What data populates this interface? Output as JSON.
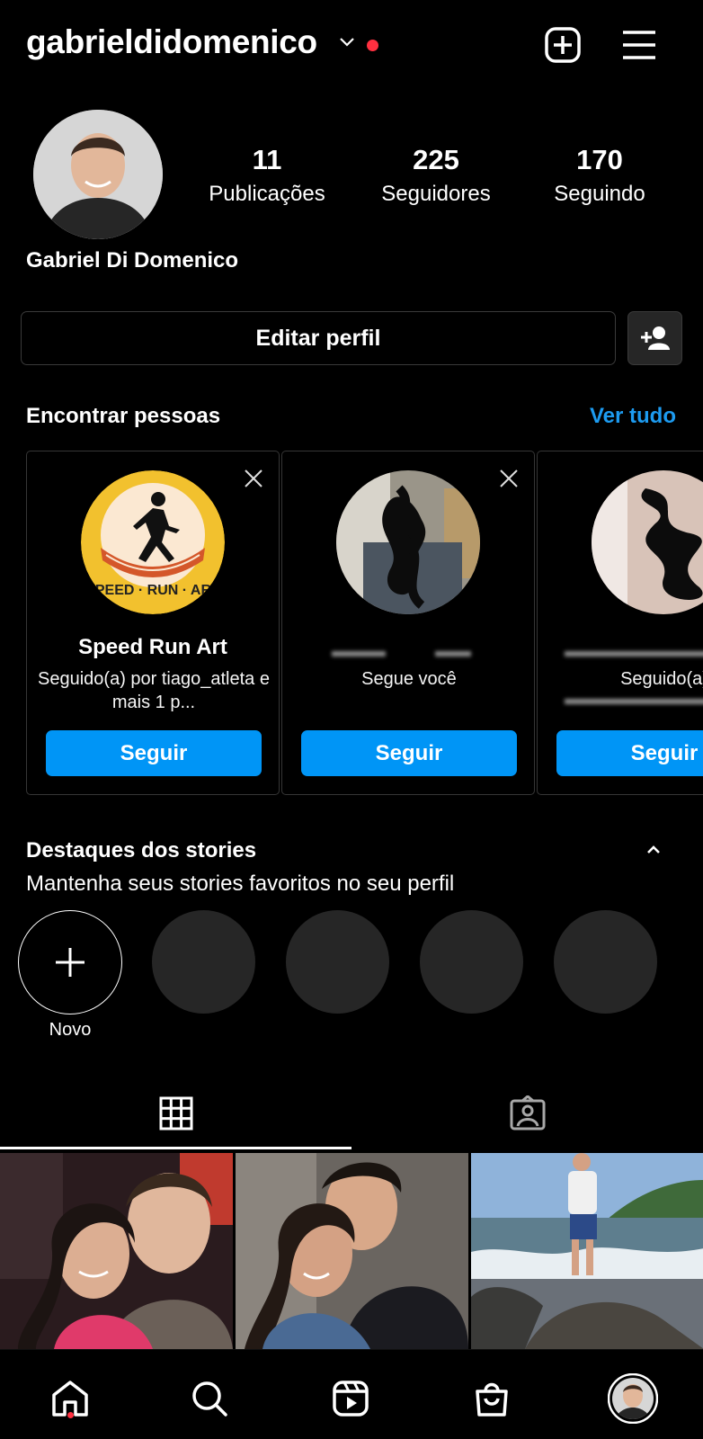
{
  "header": {
    "username": "gabrieldidomenico",
    "icons": [
      "chevron-down-icon",
      "notification-dot",
      "new-post-icon",
      "menu-icon"
    ]
  },
  "profile": {
    "full_name": "Gabriel Di Domenico",
    "stats": [
      {
        "value": "11",
        "label": "Publicações"
      },
      {
        "value": "225",
        "label": "Seguidores"
      },
      {
        "value": "170",
        "label": "Seguindo"
      }
    ],
    "edit_button": "Editar perfil"
  },
  "suggestions": {
    "title": "Encontrar pessoas",
    "see_all": "Ver tudo",
    "cards": [
      {
        "name": "Speed Run Art",
        "subtitle": "Seguido(a) por tiago_atleta e mais 1 p...",
        "button": "Seguir"
      },
      {
        "name": "",
        "subtitle": "Segue você",
        "button": "Seguir"
      },
      {
        "name": "",
        "subtitle": "Seguido(a)",
        "button": "Seguir"
      }
    ],
    "logo_text": "SPEED · RUN · ART"
  },
  "highlights": {
    "title": "Destaques dos stories",
    "subtitle": "Mantenha seus stories favoritos no seu perfil",
    "new_label": "Novo"
  },
  "tabs": [
    "grid-icon",
    "tagged-icon"
  ],
  "nav": [
    "home-icon",
    "search-icon",
    "reels-icon",
    "shop-icon",
    "profile-avatar"
  ],
  "colors": {
    "accent": "#0095f6",
    "link": "#1d9bf0",
    "notification": "#ff3040",
    "background": "#000000",
    "highlight_placeholder": "#262626"
  }
}
